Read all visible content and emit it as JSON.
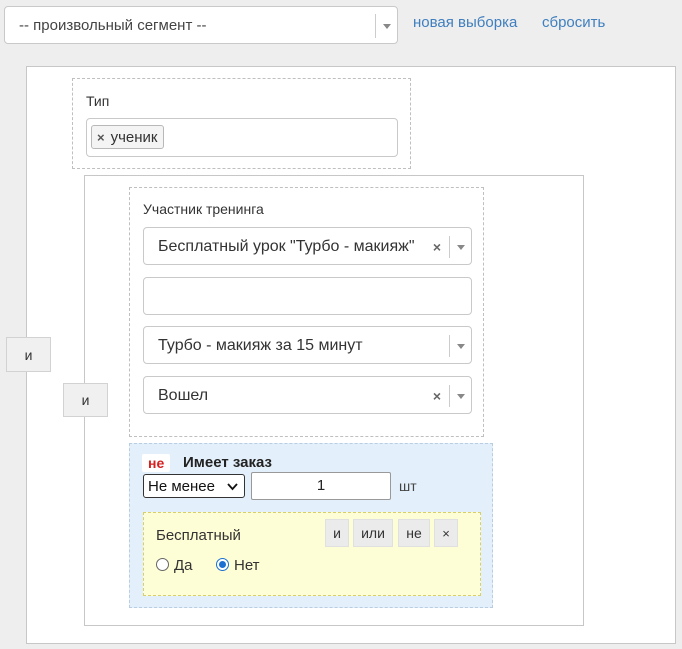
{
  "toolbar": {
    "segment_select_value": "-- произвольный сегмент --",
    "new_selection_link": "новая выборка",
    "reset_link": "сбросить"
  },
  "root_group": {
    "and_button": "и",
    "type_filter": {
      "label": "Тип",
      "tags": [
        "ученик"
      ]
    },
    "nested_group": {
      "and_button": "и",
      "training_participant": {
        "label": "Участник тренинга",
        "training_select": "Бесплатный урок \"Турбо - макияж\"",
        "empty_input": "",
        "lesson_select": "Турбо - макияж за 15 минут",
        "status_select": "Вошел"
      },
      "has_order": {
        "not_badge": "не",
        "title": "Имеет заказ",
        "comparison": "Не менее",
        "quantity": "1",
        "unit": "шт",
        "sub_condition": {
          "label": "Бесплатный",
          "buttons": [
            "и",
            "или",
            "не",
            "×"
          ],
          "options": [
            {
              "label": "Да",
              "checked": false
            },
            {
              "label": "Нет",
              "checked": true
            }
          ]
        }
      }
    }
  },
  "colors": {
    "link": "#3f7fbf",
    "not_badge": "#d42020",
    "order_block_bg": "#e3effa",
    "sub_condition_bg": "#fdfdd6"
  }
}
